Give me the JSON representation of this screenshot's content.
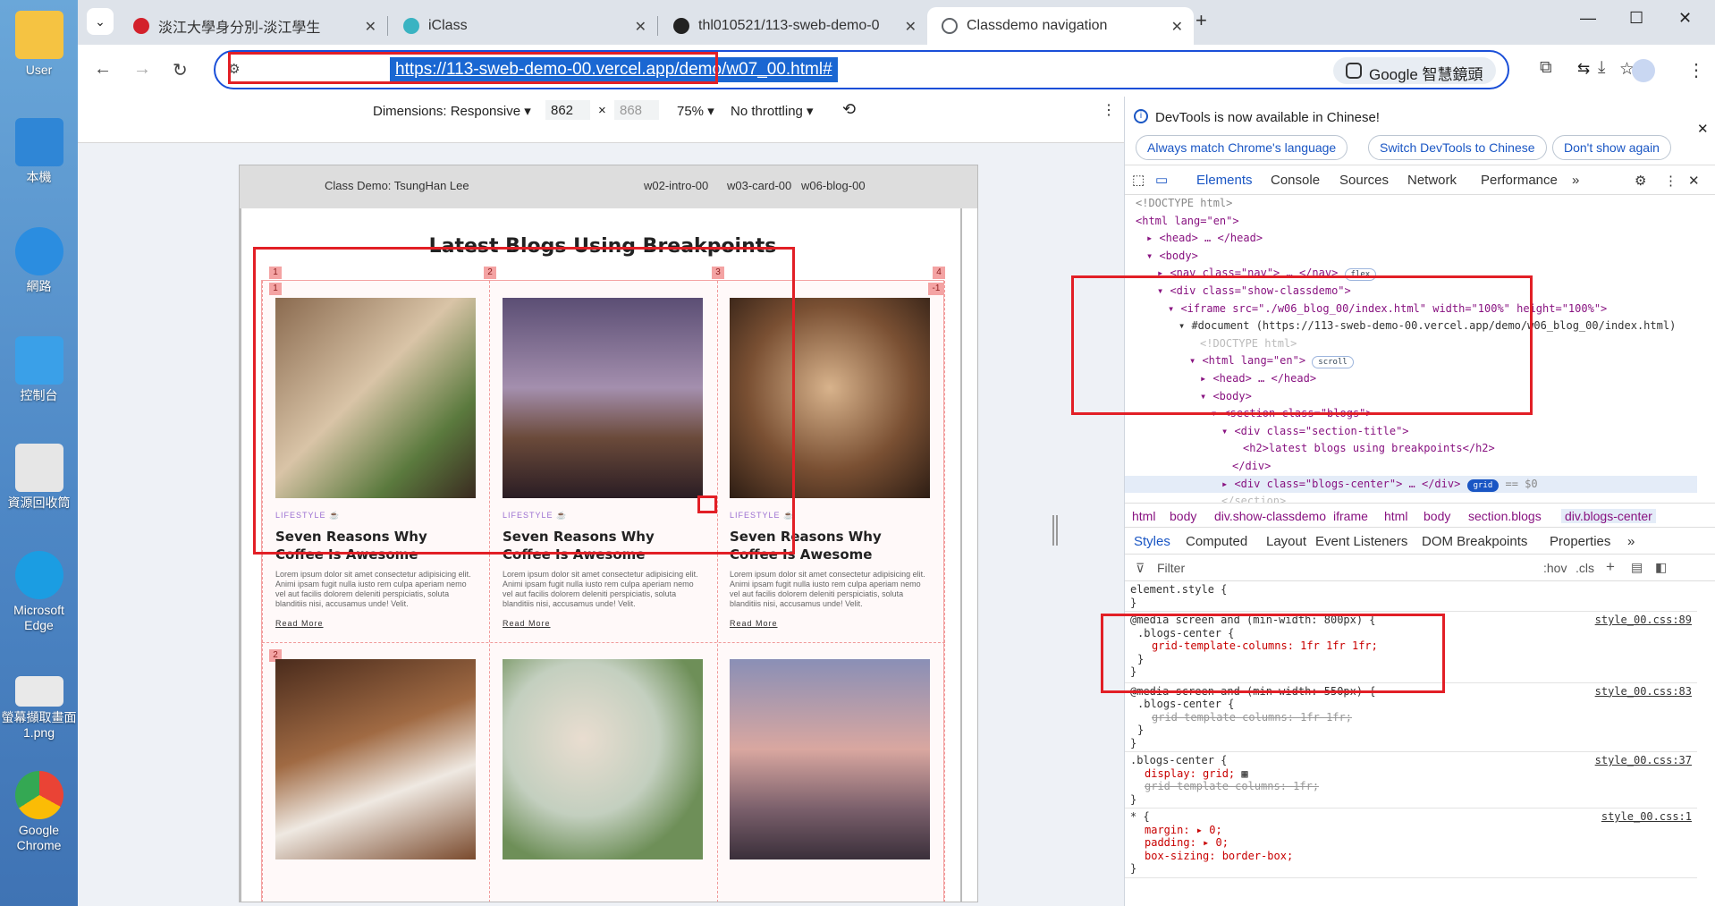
{
  "desktop": {
    "icons": [
      {
        "label": "User",
        "color": "#f5c342"
      },
      {
        "label": "本機",
        "color": "#2f86d6"
      },
      {
        "label": "網路",
        "color": "#2b8de0"
      },
      {
        "label": "控制台",
        "color": "#3aa0e8"
      },
      {
        "label": "資源回收筒",
        "color": "#e6e6e6"
      },
      {
        "label": "Microsoft Edge",
        "color": "#1b9de2"
      },
      {
        "label": "螢幕擷取畫面 1.png",
        "color": "#e9e9e9"
      },
      {
        "label": "Google Chrome",
        "color": "#34a853"
      }
    ]
  },
  "browser": {
    "tabs": [
      {
        "title": "淡江大學身分別-淡江學生",
        "icon": "tku-icon",
        "color": "#d3212b"
      },
      {
        "title": "iClass",
        "icon": "iclass-icon",
        "color": "#3ab3c2"
      },
      {
        "title": "thl010521/113-sweb-demo-0",
        "icon": "github-icon",
        "color": "#222222"
      },
      {
        "title": "Classdemo navigation",
        "icon": "globe-icon",
        "color": "#5f6368",
        "active": true
      }
    ],
    "url": "https://113-sweb-demo-00.vercel.app/demo/w07_00.html#",
    "lens_label": "Google 智慧鏡頭"
  },
  "devicebar": {
    "dimensions": "Dimensions: Responsive",
    "width": "862",
    "height": "868",
    "zoom": "75%",
    "throttle": "No throttling"
  },
  "page": {
    "brand": "Class Demo: TsungHan Lee",
    "links": [
      "w02-intro-00",
      "w03-card-00",
      "w06-blog-00"
    ],
    "heading": "Latest Blogs Using Breakpoints",
    "grid_labels": {
      "cols": [
        "1",
        "2",
        "3",
        "4"
      ],
      "rows": [
        "1",
        "2"
      ],
      "neg": "-1"
    },
    "cards": [
      {
        "category": "LIFESTYLE",
        "title": "Seven Reasons Why Coffee Is Awesome",
        "desc": "Lorem ipsum dolor sit amet consectetur adipisicing elit. Animi ipsam fugit nulla iusto rem culpa aperiam nemo vel aut facilis dolorem deleniti perspiciatis, soluta blanditiis nisi, accusamus unde! Velit.",
        "readmore": "Read More"
      },
      {
        "category": "LIFESTYLE",
        "title": "Seven Reasons Why Coffee Is Awesome",
        "desc": "Lorem ipsum dolor sit amet consectetur adipisicing elit. Animi ipsam fugit nulla iusto rem culpa aperiam nemo vel aut facilis dolorem deleniti perspiciatis, soluta blanditiis nisi, accusamus unde! Velit.",
        "readmore": "Read More"
      },
      {
        "category": "LIFESTYLE",
        "title": "Seven Reasons Why Coffee Is Awesome",
        "desc": "Lorem ipsum dolor sit amet consectetur adipisicing elit. Animi ipsam fugit nulla iusto rem culpa aperiam nemo vel aut facilis dolorem deleniti perspiciatis, soluta blanditiis nisi, accusamus unde! Velit.",
        "readmore": "Read More"
      }
    ]
  },
  "devtools": {
    "banner": "DevTools is now available in Chinese!",
    "pills": [
      "Always match Chrome's language",
      "Switch DevTools to Chinese",
      "Don't show again"
    ],
    "tabs": [
      "Elements",
      "Console",
      "Sources",
      "Network",
      "Performance"
    ],
    "dom": [
      "<!DOCTYPE html>",
      "<html lang=\"en\">",
      "<head> … </head>",
      "<body>",
      "<nav class=\"nav\"> … </nav>",
      "<div class=\"show-classdemo\">",
      "<iframe src=\"./w06_blog_00/index.html\" width=\"100%\" height=\"100%\">",
      "#document (https://113-sweb-demo-00.vercel.app/demo/w06_blog_00/index.html)",
      "<!DOCTYPE html>",
      "<html lang=\"en\">",
      "<head> … </head>",
      "<body>",
      "<section class=\"blogs\">",
      "<div class=\"section-title\">",
      "<h2>latest blogs using breakpoints</h2>",
      "</div>",
      "<div class=\"blogs-center\"> … </div>",
      "</section>"
    ],
    "badges": {
      "flex": "flex",
      "scroll": "scroll",
      "grid": "grid",
      "dollar": "== $0"
    },
    "breadcrumbs": [
      "html",
      "body",
      "div.show-classdemo",
      "iframe",
      "html",
      "body",
      "section.blogs",
      "div.blogs-center"
    ],
    "style_tabs": [
      "Styles",
      "Computed",
      "Layout",
      "Event Listeners",
      "DOM Breakpoints",
      "Properties"
    ],
    "filter_placeholder": "Filter",
    "filter_hov": ":hov",
    "filter_cls": ".cls",
    "rules": [
      {
        "selector": "element.style {",
        "lines": [
          "}"
        ],
        "src": ""
      },
      {
        "selector": "@media screen and (min-width: 800px) {",
        "sub": ".blogs-center {",
        "lines": [
          "grid-template-columns: 1fr 1fr 1fr;",
          "}",
          "}"
        ],
        "src": "style_00.css:89"
      },
      {
        "selector": "@media screen and (min-width: 550px) {",
        "sub": ".blogs-center {",
        "lines": [
          "grid-template-columns: 1fr 1fr;",
          "}",
          "}"
        ],
        "src": "style_00.css:83",
        "struck": [
          0
        ]
      },
      {
        "selector": ".blogs-center {",
        "lines": [
          "display: grid;",
          "grid-template-columns: 1fr;",
          "}"
        ],
        "src": "style_00.css:37",
        "struck": [
          1
        ]
      },
      {
        "selector": "* {",
        "lines": [
          "margin: ▸ 0;",
          "padding: ▸ 0;",
          "box-sizing: border-box;",
          "}"
        ],
        "src": "style_00.css:1"
      }
    ]
  }
}
